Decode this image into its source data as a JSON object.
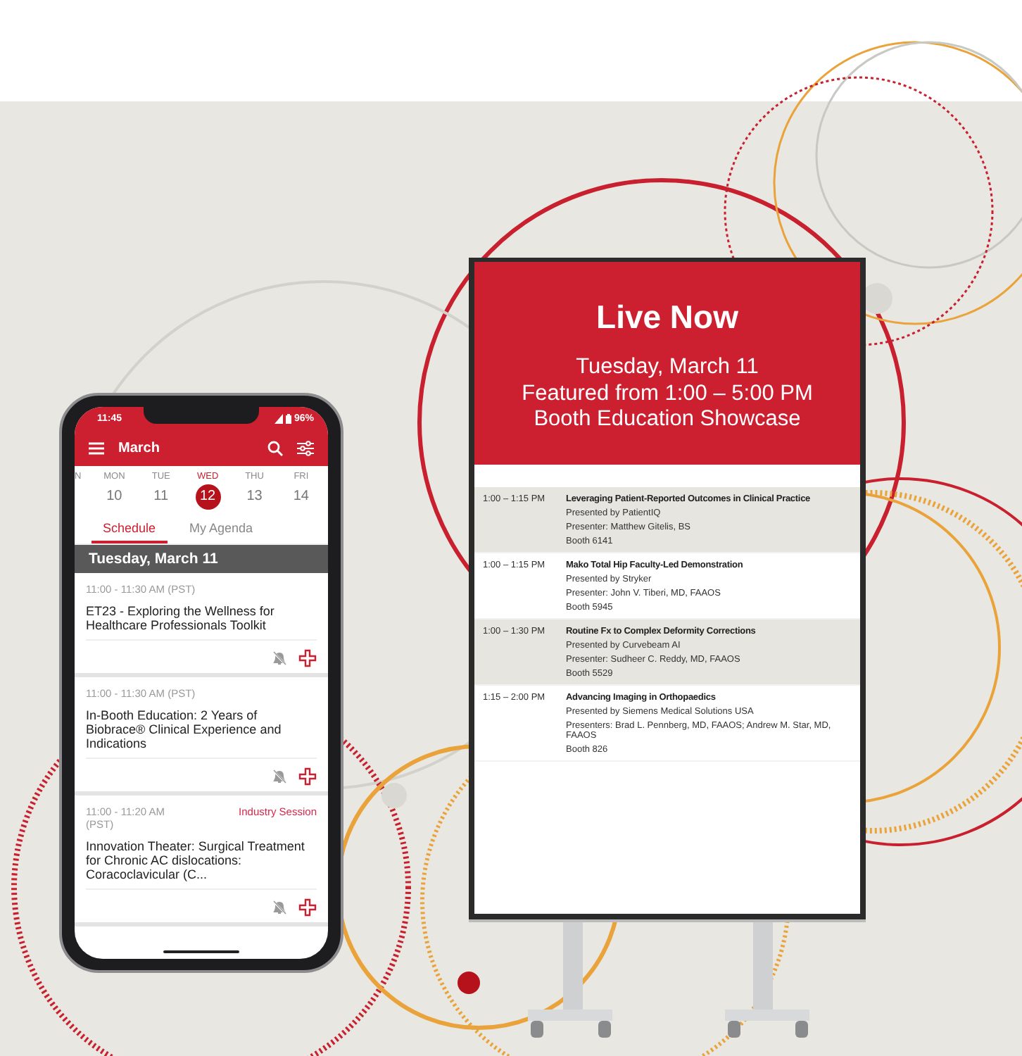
{
  "phone": {
    "status_bar": {
      "time": "11:45",
      "battery": "96%"
    },
    "header": {
      "title": "March"
    },
    "days": [
      {
        "label": "N",
        "selected": false
      },
      {
        "label": "MON",
        "date": "10",
        "selected": false
      },
      {
        "label": "TUE",
        "date": "11",
        "selected": false
      },
      {
        "label": "WED",
        "date": "12",
        "selected": true
      },
      {
        "label": "THU",
        "date": "13",
        "selected": false
      },
      {
        "label": "FRI",
        "date": "14",
        "selected": false
      }
    ],
    "tabs": [
      {
        "label": "Schedule",
        "selected": true
      },
      {
        "label": "My Agenda",
        "selected": false
      }
    ],
    "date_header": "Tuesday, March 11",
    "sessions": [
      {
        "time": "11:00 - 11:30 AM (PST)",
        "title": "ET23 - Exploring the Wellness for Healthcare Professionals Toolkit"
      },
      {
        "time": "11:00 - 11:30 AM (PST)",
        "title": "In-Booth Education: 2 Years of Biobrace® Clinical Experience and Indications"
      },
      {
        "time": "11:00 - 11:20 AM (PST)",
        "tag": "Industry Session",
        "title": "Innovation Theater: Surgical Treatment for Chronic AC dislocations: Coracoclavicular (C..."
      }
    ]
  },
  "display": {
    "title": "Live Now",
    "subtitle_lines": [
      "Tuesday, March 11",
      "Featured from 1:00 – 5:00 PM",
      "Booth Education Showcase"
    ],
    "sessions": [
      {
        "time": "1:00 – 1:15 PM",
        "title": "Leveraging Patient-Reported Outcomes in Clinical Practice",
        "presented_by": "Presented by PatientIQ",
        "presenters": "Presenter: Matthew Gitelis, BS",
        "booth": "Booth 6141",
        "shaded": true
      },
      {
        "time": "1:00 – 1:15 PM",
        "title": "Mako Total Hip Faculty-Led Demonstration",
        "presented_by": "Presented by Stryker",
        "presenters": "Presenter: John V. Tiberi, MD, FAAOS",
        "booth": "Booth 5945",
        "shaded": false
      },
      {
        "time": "1:00 – 1:30 PM",
        "title": "Routine Fx to Complex Deformity Corrections",
        "presented_by": "Presented by Curvebeam AI",
        "presenters": "Presenter: Sudheer C. Reddy, MD, FAAOS",
        "booth": "Booth 5529",
        "shaded": true
      },
      {
        "time": "1:15 – 2:00 PM",
        "title": "Advancing Imaging in Orthopaedics",
        "presented_by": "Presented by Siemens Medical Solutions USA",
        "presenters": "Presenters: Brad L. Pennberg, MD, FAAOS; Andrew M. Star, MD, FAAOS",
        "booth": "Booth 826",
        "shaded": false
      }
    ]
  }
}
